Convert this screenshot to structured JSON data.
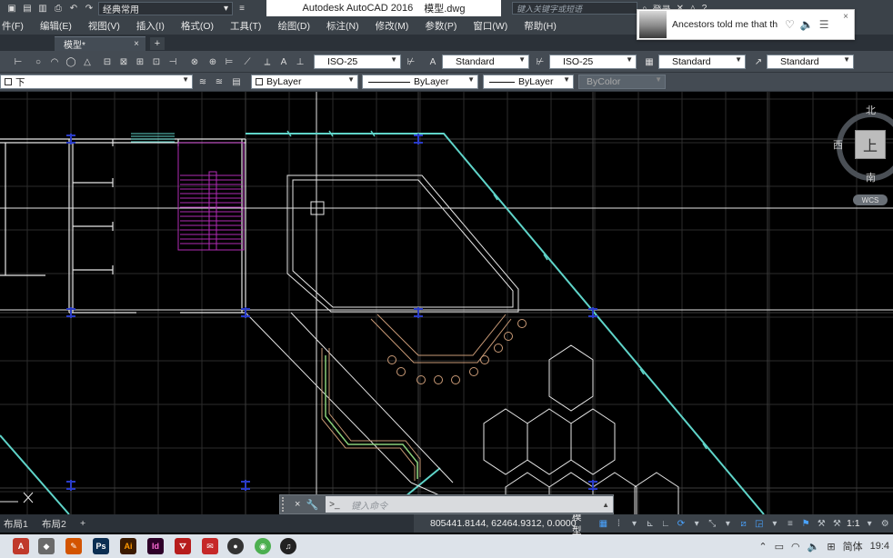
{
  "titlebar": {
    "workspace": "经典常用",
    "app_title": "Autodesk AutoCAD 2016",
    "file_name": "模型.dwg",
    "search_placeholder": "键入关键字或短语",
    "signin": "登录",
    "help": "?"
  },
  "notification": {
    "text": "Ancestors told me that th",
    "like_icon": "heart-icon",
    "sound_icon": "speaker-icon",
    "menu_icon": "list-icon",
    "close": "×"
  },
  "menu": [
    "件(F)",
    "编辑(E)",
    "视图(V)",
    "插入(I)",
    "格式(O)",
    "工具(T)",
    "绘图(D)",
    "标注(N)",
    "修改(M)",
    "参数(P)",
    "窗口(W)",
    "帮助(H)"
  ],
  "tabs": {
    "active": "模型*",
    "close": "×",
    "add": "+"
  },
  "toolbar1": {
    "dim_style": "ISO-25",
    "text_style": "Standard",
    "dim_style2": "ISO-25",
    "table_style": "Standard",
    "multileader_style": "Standard"
  },
  "toolbar2": {
    "layer": "下",
    "color": "ByLayer",
    "linetype": "ByLayer",
    "lineweight": "ByLayer",
    "plotstyle": "ByColor"
  },
  "viewcube": {
    "north": "北",
    "south": "南",
    "west": "西",
    "face": "上",
    "wcs": "WCS"
  },
  "command": {
    "placeholder": "键入命令",
    "close": "×",
    "settings": "🔧",
    "prefix": ">_"
  },
  "layout_tabs": [
    "布局1",
    "布局2",
    "+"
  ],
  "status": {
    "coordinates": "805441.8144, 62464.9312, 0.0000",
    "space": "模型",
    "scale": "1:1"
  },
  "tray": {
    "ime": "简体",
    "time": "19:4"
  },
  "colors": {
    "cyan": "#5fd4c9",
    "magenta": "#b02bb4",
    "pale": "#e6e6e6",
    "orange": "#c99a76",
    "green": "#8ad07a",
    "blue": "#2a3cc8",
    "grid": "#2c2c2c",
    "grid_major": "#3e3e3e"
  }
}
